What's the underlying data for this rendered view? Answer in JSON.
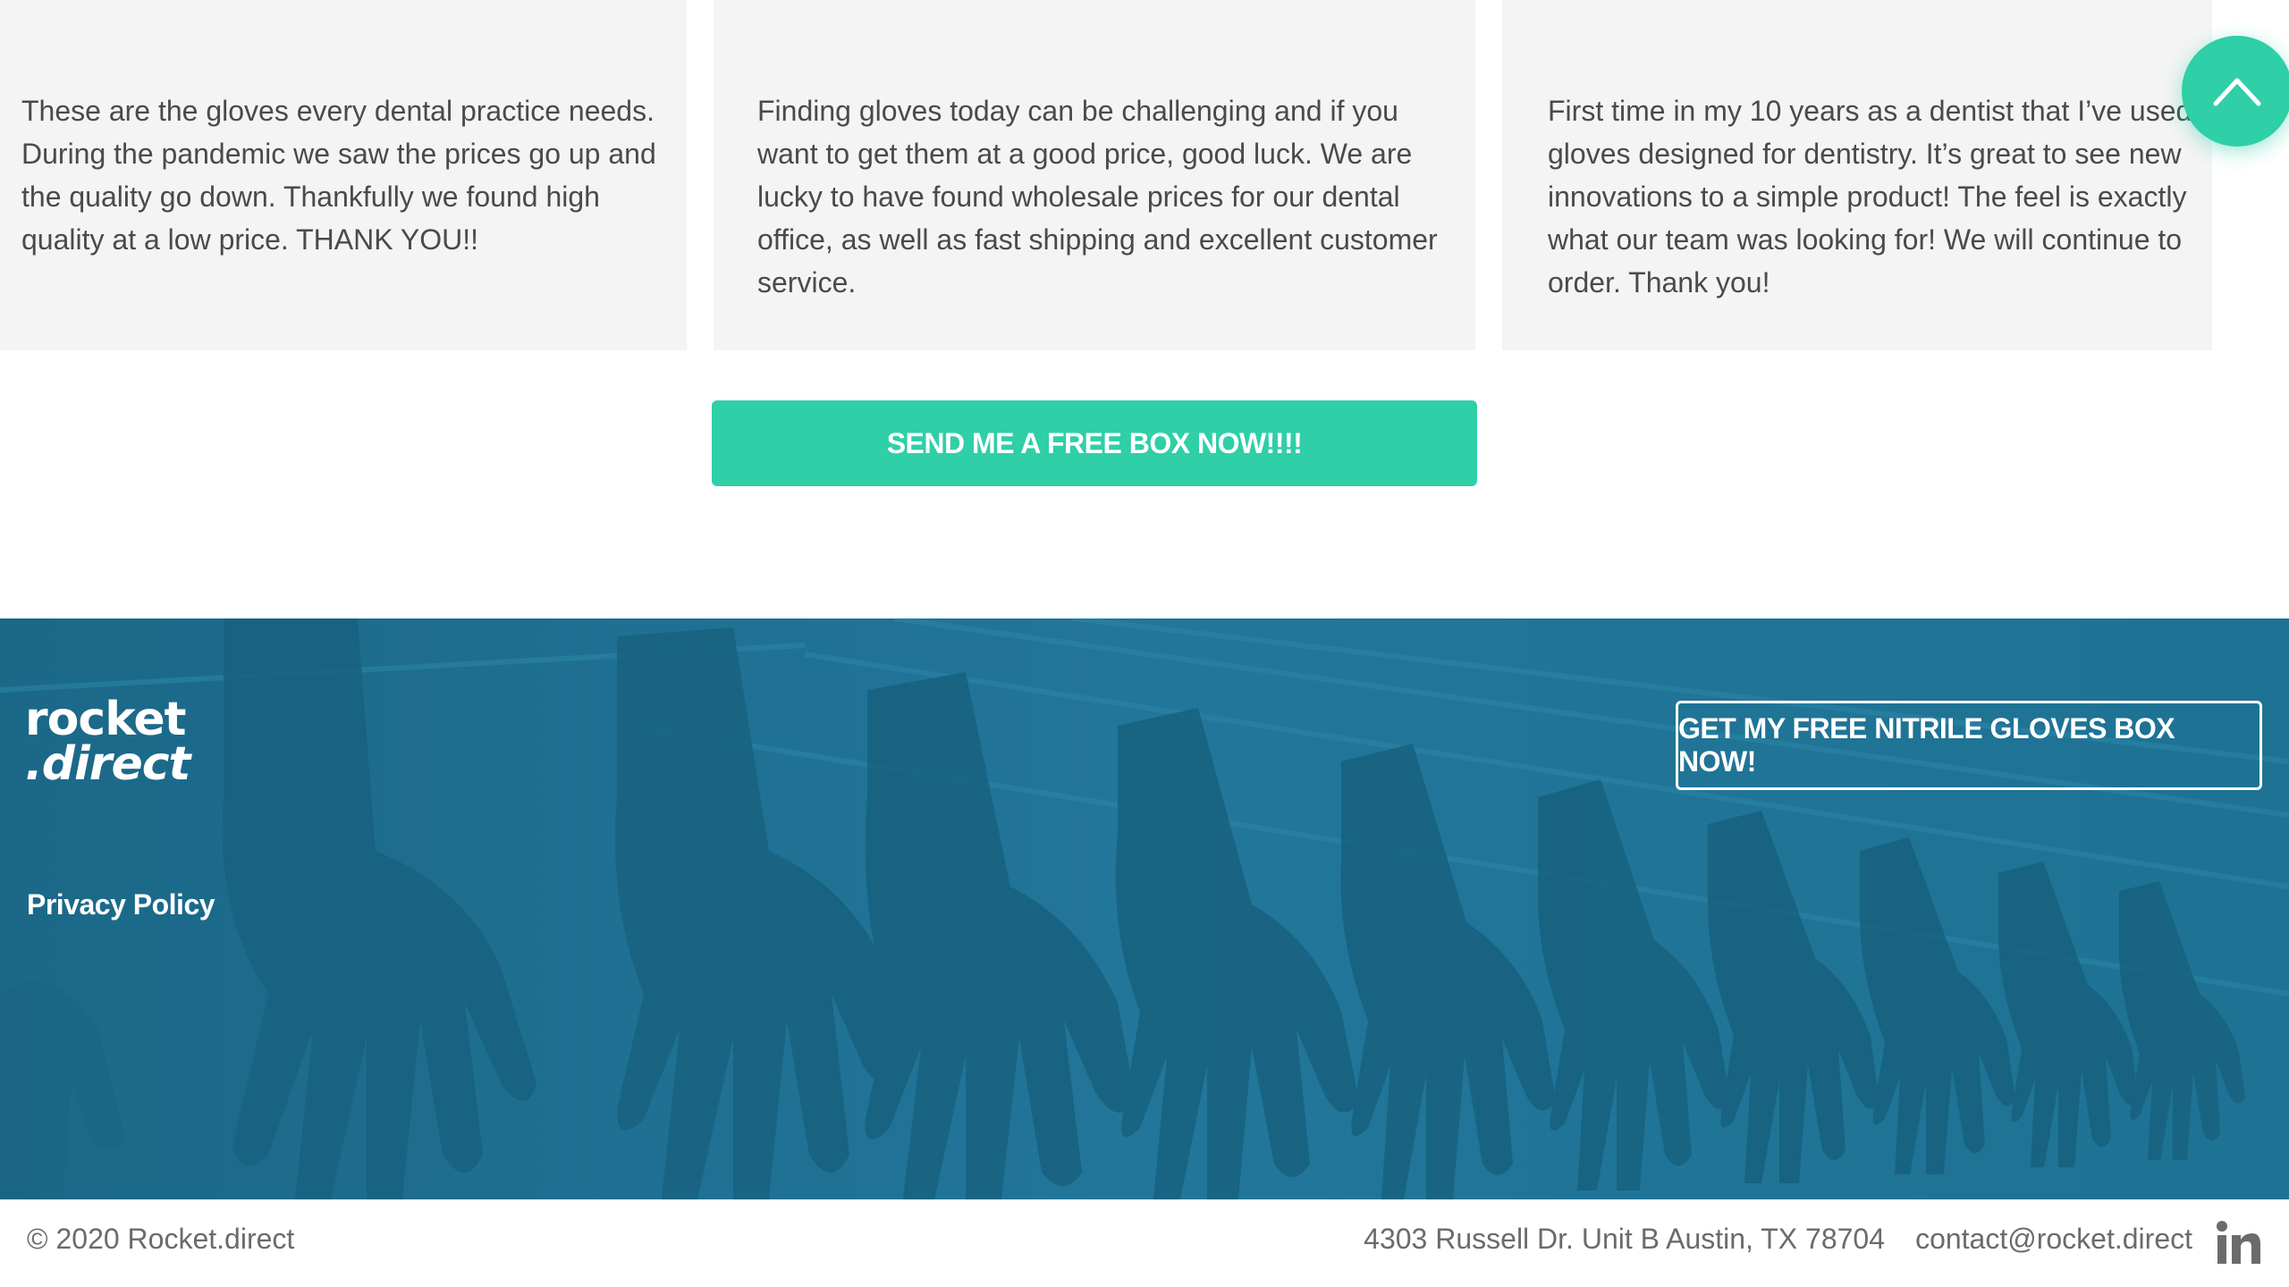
{
  "testimonials": [
    {
      "text": "These are the gloves every dental practice needs. During the pandemic we saw the prices go up and the quality go down. Thankfully we found high quality at a low price. THANK YOU!!"
    },
    {
      "text": "Finding gloves today can be challenging and if you want to get them at a good price, good luck. We are lucky to have found wholesale prices for our dental office, as well as fast shipping and excellent customer service."
    },
    {
      "text": "First time in my 10 years as a dentist that I’ve used gloves designed for dentistry. It’s great to see new innovations to a simple product! The feel is exactly what our team was looking for! We will continue to order. Thank you!"
    }
  ],
  "cta_main": {
    "label": "SEND ME A FREE BOX NOW!!!!"
  },
  "scroll_top": {
    "icon": "chevron-up-icon"
  },
  "footer": {
    "logo_line1": "rocket",
    "logo_line2": ".direct",
    "privacy_label": "Privacy Policy",
    "cta_label": "GET MY FREE NITRILE GLOVES BOX NOW!"
  },
  "bottom_bar": {
    "copyright": "© 2020 Rocket.direct",
    "address": "4303 Russell Dr. Unit B Austin, TX 78704",
    "email": "contact@rocket.direct",
    "social_icon": "linkedin-icon"
  },
  "colors": {
    "accent": "#2fcfa8",
    "footer_bg": "#1e6e8c",
    "card_bg": "#f4f4f4",
    "text": "#4a4a4a"
  }
}
